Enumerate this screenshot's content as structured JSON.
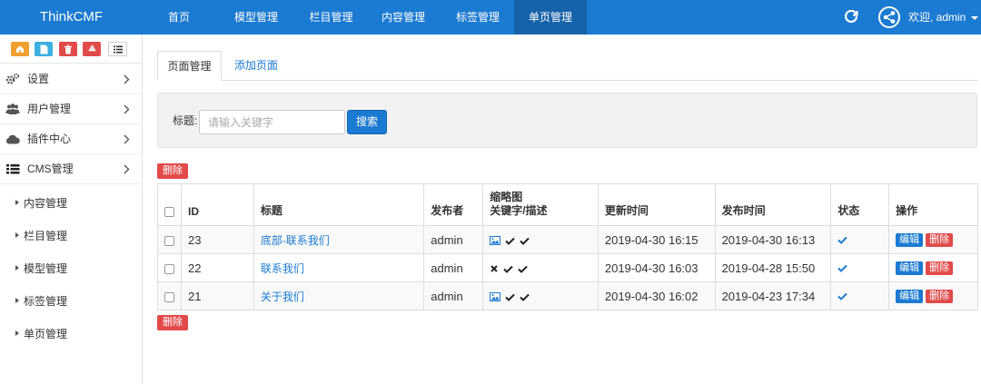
{
  "brand": "ThinkCMF",
  "nav": {
    "items": [
      {
        "label": "首页"
      },
      {
        "label": "模型管理"
      },
      {
        "label": "栏目管理"
      },
      {
        "label": "内容管理"
      },
      {
        "label": "标签管理"
      },
      {
        "label": "单页管理",
        "active": true
      }
    ],
    "user": "欢迎, admin",
    "refresh_icon": "refresh-icon",
    "avatar_icon": "share-avatar-icon"
  },
  "sidebar": {
    "shortcuts": [
      {
        "icon": "home-icon",
        "color": "#f0a030"
      },
      {
        "icon": "file-icon",
        "color": "#3ab0e0"
      },
      {
        "icon": "trash-icon",
        "color": "#e04b4a"
      },
      {
        "icon": "recycle-icon",
        "color": "#e04b4a"
      },
      {
        "icon": "list-icon",
        "color": "#ffffff"
      }
    ],
    "menu": [
      {
        "label": "设置",
        "icon": "cogs-icon"
      },
      {
        "label": "用户管理",
        "icon": "users-icon"
      },
      {
        "label": "插件中心",
        "icon": "cloud-icon"
      },
      {
        "label": "CMS管理",
        "icon": "list-icon"
      }
    ],
    "submenu": [
      {
        "label": "内容管理"
      },
      {
        "label": "栏目管理"
      },
      {
        "label": "模型管理"
      },
      {
        "label": "标签管理"
      },
      {
        "label": "单页管理"
      }
    ]
  },
  "tabs": [
    {
      "label": "页面管理",
      "active": true
    },
    {
      "label": "添加页面",
      "active": false
    }
  ],
  "filter": {
    "label": "标题:",
    "placeholder": "请输入关键字",
    "value": "",
    "search_label": "搜索"
  },
  "delete_label": "删除",
  "table": {
    "headers": {
      "id": "ID",
      "title": "标题",
      "author": "发布者",
      "thumb_line1": "缩略图",
      "thumb_line2": "关键字/描述",
      "updated": "更新时间",
      "published": "发布时间",
      "status": "状态",
      "ops": "操作"
    },
    "rows": [
      {
        "id": "23",
        "title": "底部-联系我们",
        "author": "admin",
        "has_thumb": true,
        "has_keywords": true,
        "has_desc": true,
        "updated": "2019-04-30 16:15",
        "published": "2019-04-30 16:13",
        "status": "published",
        "edit": "编辑",
        "delete": "删除"
      },
      {
        "id": "22",
        "title": "联系我们",
        "author": "admin",
        "has_thumb": false,
        "has_keywords": true,
        "has_desc": true,
        "updated": "2019-04-30 16:03",
        "published": "2019-04-28 15:50",
        "status": "published",
        "edit": "编辑",
        "delete": "删除"
      },
      {
        "id": "21",
        "title": "关于我们",
        "author": "admin",
        "has_thumb": true,
        "has_keywords": true,
        "has_desc": true,
        "updated": "2019-04-30 16:02",
        "published": "2019-04-23 17:34",
        "status": "published",
        "edit": "编辑",
        "delete": "删除"
      }
    ]
  },
  "colors": {
    "primary": "#1b7ad1",
    "danger": "#e04b4a",
    "nav_bg": "#1b7ad1",
    "nav_active": "#1763aa"
  }
}
